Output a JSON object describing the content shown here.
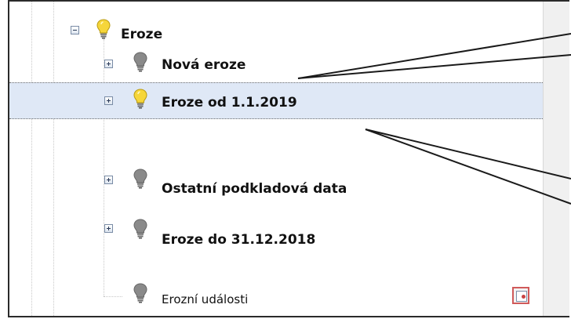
{
  "tree": {
    "items": [
      {
        "label": "Eroze",
        "expander": "minus",
        "bulb": "yellow",
        "bold": true
      },
      {
        "label": "Nová eroze",
        "expander": "plus",
        "bulb": "gray",
        "bold": true
      },
      {
        "label": "Eroze od 1.1.2019",
        "expander": "plus",
        "bulb": "yellow",
        "bold": true,
        "selected": true
      },
      {
        "label": "Ostatní podkladová data",
        "expander": "plus",
        "bulb": "gray",
        "bold": true
      },
      {
        "label": "Eroze do 31.12.2018",
        "expander": "plus",
        "bulb": "gray",
        "bold": true
      },
      {
        "label": "Erozní události",
        "expander": "none",
        "bulb": "gray",
        "bold": false
      }
    ]
  },
  "colors": {
    "bulb_on": "#f6d63a",
    "bulb_off": "#8a8a8a",
    "selection": "#dfe8f6",
    "map_button_border": "#d05a5a"
  },
  "icons": {
    "expander_minus": "minus-box-icon",
    "expander_plus": "plus-box-icon",
    "bulb": "light-bulb-icon",
    "map": "map-layer-icon"
  }
}
